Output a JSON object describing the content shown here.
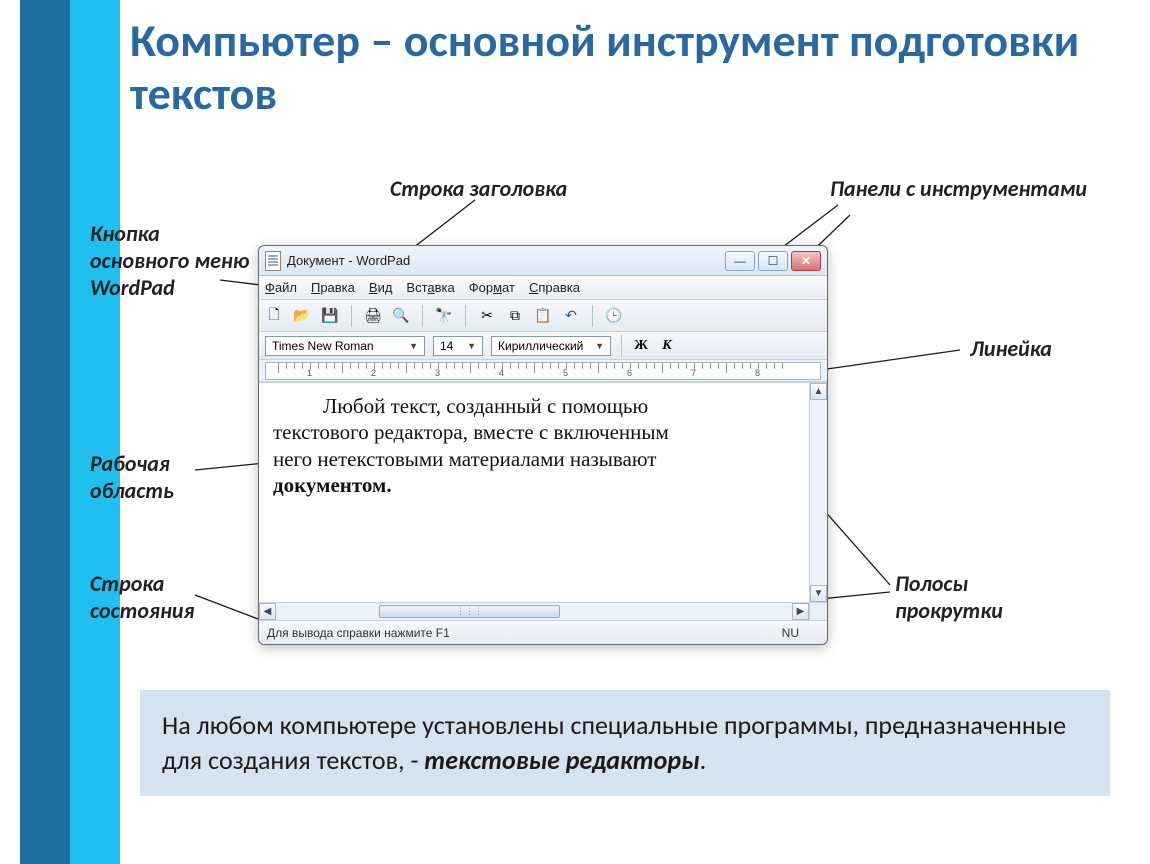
{
  "slide": {
    "title": "Компьютер – основной инструмент подготовки текстов"
  },
  "labels": {
    "main_button": "Кнопка основного меню WordPad",
    "title_bar": "Строка заголовка",
    "tool_panels": "Панели  с инструментами",
    "ruler": "Линейка",
    "workarea": "Рабочая область",
    "status": "Строка состояния",
    "scrollbars": "Полосы прокрутки"
  },
  "window": {
    "title": "Документ - WordPad",
    "menu": {
      "file": "Файл",
      "edit": "Правка",
      "view": "Вид",
      "insert": "Вставка",
      "format": "Формат",
      "help": "Справка"
    },
    "toolbar_icons": {
      "new": "new-file-icon",
      "open": "open-icon",
      "save": "save-icon",
      "print": "print-icon",
      "preview": "preview-icon",
      "find": "find-icon",
      "cut": "cut-icon",
      "copy": "copy-icon",
      "paste": "paste-icon",
      "undo": "undo-icon",
      "datetime": "datetime-icon"
    },
    "format": {
      "font": "Times New Roman",
      "size": "14",
      "script": "Кириллический",
      "bold": "Ж",
      "italic": "К"
    },
    "ruler_numbers": [
      "1",
      "2",
      "3",
      "4",
      "5",
      "6",
      "7",
      "8"
    ],
    "doc_text": {
      "line1": "Любой текст, созданный с помощью",
      "line2": "текстового редактора, вместе с включенным",
      "line3": "него нетекстовыми материалами называют",
      "line4": "документом."
    },
    "status": {
      "help": "Для вывода справки нажмите F1",
      "mode": "NU"
    }
  },
  "footer": {
    "text_pre": "На любом компьютере установлены специальные программы, предназначенные для создания текстов, - ",
    "emph": "текстовые редакторы",
    "text_post": "."
  }
}
